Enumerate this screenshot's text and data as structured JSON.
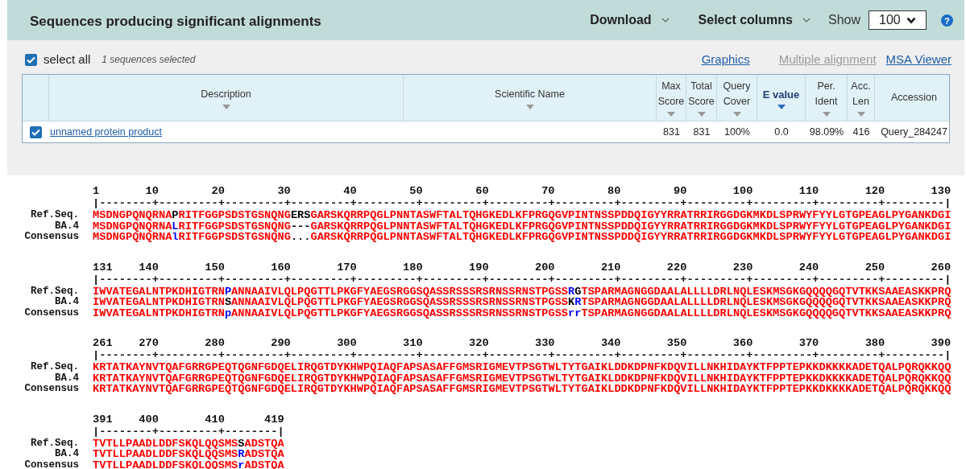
{
  "header": {
    "title": "Sequences producing significant alignments",
    "menus": [
      "Download",
      "Select columns"
    ],
    "show_label": "Show",
    "show_value": "100",
    "help": "?"
  },
  "toolbar": {
    "select_all": {
      "label": "select all",
      "checked": true
    },
    "selected_count": "1 sequences selected",
    "links": [
      {
        "label": "Graphics",
        "disabled": false
      },
      {
        "label": "Multiple alignment",
        "disabled": true
      },
      {
        "label": "MSA Viewer",
        "disabled": false
      }
    ]
  },
  "table": {
    "columns": [
      {
        "label": "Description",
        "selected": false
      },
      {
        "label": "Scientific Name",
        "selected": false
      },
      {
        "label": "Max Score",
        "selected": false
      },
      {
        "label": "Total Score",
        "selected": false
      },
      {
        "label": "Query Cover",
        "selected": false
      },
      {
        "label": "E value",
        "selected": true
      },
      {
        "label": "Per. Ident",
        "selected": false
      },
      {
        "label": "Acc. Len",
        "selected": false
      },
      {
        "label": "Accession",
        "selected": false
      }
    ],
    "rows": [
      {
        "checked": true,
        "cells": [
          "unnamed protein product",
          "",
          "831",
          "831",
          "100%",
          "0.0",
          "98.09%",
          "416",
          "Query_284247"
        ]
      }
    ]
  },
  "alignment": {
    "blocks": [
      {
        "numbers": [
          "1",
          "10",
          "20",
          "30",
          "40",
          "50",
          "60",
          "70",
          "80",
          "90",
          "100",
          "110",
          "120",
          "130"
        ],
        "ruler": "|--------+---------+---------+---------+---------+---------+---------+---------+---------+---------+---------+---------+---------|",
        "rows": [
          {
            "label": "Ref.Seq.",
            "segments": [
              {
                "text": "MSDNGPQNQRNA",
                "color": "#ff0000"
              },
              {
                "text": "P",
                "color": "#000000"
              },
              {
                "text": "RITFGGPSDSTGSNQNG",
                "color": "#ff0000"
              },
              {
                "text": "ERS",
                "color": "#000000"
              },
              {
                "text": "GARSKQRRPQGLPNNTASWFTALTQHGKEDLKFPRGQGVPINTNSSPDDQIGYYRRATRRIRGGDGKMKDLSPRWYFYYLGTGPEAGLPYGANKDGI",
                "color": "#ff0000"
              }
            ]
          },
          {
            "label": "BA.4",
            "segments": [
              {
                "text": "MSDNGPQNQRNA",
                "color": "#ff0000"
              },
              {
                "text": "L",
                "color": "#0000ff"
              },
              {
                "text": "RITFGGPSDSTGSNQNG",
                "color": "#ff0000"
              },
              {
                "text": "---",
                "color": "#000000"
              },
              {
                "text": "GARSKQRRPQGLPNNTASWFTALTQHGKEDLKFPRGQGVPINTNSSPDDQIGYYRRATRRIRGGDGKMKDLSPRWYFYYLGTGPEAGLPYGANKDGI",
                "color": "#ff0000"
              }
            ]
          },
          {
            "label": "Consensus",
            "segments": [
              {
                "text": "MSDNGPQNQRNA",
                "color": "#ff0000"
              },
              {
                "text": "l",
                "color": "#0000ff"
              },
              {
                "text": "RITFGGPSDSTGSNQNG",
                "color": "#ff0000"
              },
              {
                "text": "...",
                "color": "#000000"
              },
              {
                "text": "GARSKQRRPQGLPNNTASWFTALTQHGKEDLKFPRGQGVPINTNSSPDDQIGYYRRATRRIRGGDGKMKDLSPRWYFYYLGTGPEAGLPYGANKDGI",
                "color": "#ff0000"
              }
            ]
          }
        ]
      },
      {
        "numbers": [
          "131",
          "140",
          "150",
          "160",
          "170",
          "180",
          "190",
          "200",
          "210",
          "220",
          "230",
          "240",
          "250",
          "260"
        ],
        "ruler": "|--------+---------+---------+---------+---------+---------+---------+---------+---------+---------+---------+---------+---------|",
        "rows": [
          {
            "label": "Ref.Seq.",
            "segments": [
              {
                "text": "IWVATEGALNTPKDHIGTRN",
                "color": "#ff0000"
              },
              {
                "text": "P",
                "color": "#0000ff"
              },
              {
                "text": "ANNAAIVLQLPQGTTLPKGFYAEGSRGGSQASSRSSSRSRNSSRNSTPGSS",
                "color": "#ff0000"
              },
              {
                "text": "R",
                "color": "#0000ff"
              },
              {
                "text": "G",
                "color": "#000000"
              },
              {
                "text": "TSPARMAGNGGDAALALLLLDRLNQLESKMSGKGQQQQGQTVTKKSAAEASKKPRQ",
                "color": "#ff0000"
              }
            ]
          },
          {
            "label": "BA.4",
            "segments": [
              {
                "text": "IWVATEGALNTPKDHIGTRN",
                "color": "#ff0000"
              },
              {
                "text": "S",
                "color": "#000000"
              },
              {
                "text": "ANNAAIVLQLPQGTTLPKGFYAEGSRGGSQASSRSSSRSRNSSRNSTPGSS",
                "color": "#ff0000"
              },
              {
                "text": "K",
                "color": "#000000"
              },
              {
                "text": "R",
                "color": "#0000ff"
              },
              {
                "text": "TSPARMAGNGGDAALALLLLDRLNQLESKMSGKGQQQQGQTVTKKSAAEASKKPRQ",
                "color": "#ff0000"
              }
            ]
          },
          {
            "label": "Consensus",
            "segments": [
              {
                "text": "IWVATEGALNTPKDHIGTRN",
                "color": "#ff0000"
              },
              {
                "text": "p",
                "color": "#0000ff"
              },
              {
                "text": "ANNAAIVLQLPQGTTLPKGFYAEGSRGGSQASSRSSSRSRNSSRNSTPGSS",
                "color": "#ff0000"
              },
              {
                "text": "rr",
                "color": "#0000ff"
              },
              {
                "text": "TSPARMAGNGGDAALALLLLDRLNQLESKMSGKGQQQQGQTVTKKSAAEASKKPRQ",
                "color": "#ff0000"
              }
            ]
          }
        ]
      },
      {
        "numbers": [
          "261",
          "270",
          "280",
          "290",
          "300",
          "310",
          "320",
          "330",
          "340",
          "350",
          "360",
          "370",
          "380",
          "390"
        ],
        "ruler": "|--------+---------+---------+---------+---------+---------+---------+---------+---------+---------+---------+---------+---------|",
        "rows": [
          {
            "label": "Ref.Seq.",
            "segments": [
              {
                "text": "KRTATKAYNVTQAFGRRGPEQTQGNFGDQELIRQGTDYKHWPQIAQFAPSASAFFGMSRIGMEVTPSGTWLTYTGAIKLDDKDPNFKDQVILLNKHIDAYKTFPPTEPKKDKKKKADETQALPQRQKKQQ",
                "color": "#ff0000"
              }
            ]
          },
          {
            "label": "BA.4",
            "segments": [
              {
                "text": "KRTATKAYNVTQAFGRRGPEQTQGNFGDQELIRQGTDYKHWPQIAQFAPSASAFFGMSRIGMEVTPSGTWLTYTGAIKLDDKDPNFKDQVILLNKHIDAYKTFPPTEPKKDKKKKADETQALPQRQKKQQ",
                "color": "#ff0000"
              }
            ]
          },
          {
            "label": "Consensus",
            "segments": [
              {
                "text": "KRTATKAYNVTQAFGRRGPEQTQGNFGDQELIRQGTDYKHWPQIAQFAPSASAFFGMSRIGMEVTPSGTWLTYTGAIKLDDKDPNFKDQVILLNKHIDAYKTFPPTEPKKDKKKKADETQALPQRQKKQQ",
                "color": "#ff0000"
              }
            ]
          }
        ]
      },
      {
        "numbers": [
          "391",
          "400",
          "410",
          "419"
        ],
        "ruler": "|--------+---------+--------|",
        "rows": [
          {
            "label": "Ref.Seq.",
            "segments": [
              {
                "text": "TVTLLPAADLDDFSKQLQQSMS",
                "color": "#ff0000"
              },
              {
                "text": "S",
                "color": "#000000"
              },
              {
                "text": "ADSTQA",
                "color": "#ff0000"
              }
            ]
          },
          {
            "label": "BA.4",
            "segments": [
              {
                "text": "TVTLLPAADLDDFSKQLQQSMS",
                "color": "#ff0000"
              },
              {
                "text": "R",
                "color": "#0000ff"
              },
              {
                "text": "ADSTQA",
                "color": "#ff0000"
              }
            ]
          },
          {
            "label": "Consensus",
            "segments": [
              {
                "text": "TVTLLPAADLDDFSKQLQQSMS",
                "color": "#ff0000"
              },
              {
                "text": "r",
                "color": "#0000ff"
              },
              {
                "text": "ADSTQA",
                "color": "#ff0000"
              }
            ]
          }
        ]
      }
    ]
  }
}
